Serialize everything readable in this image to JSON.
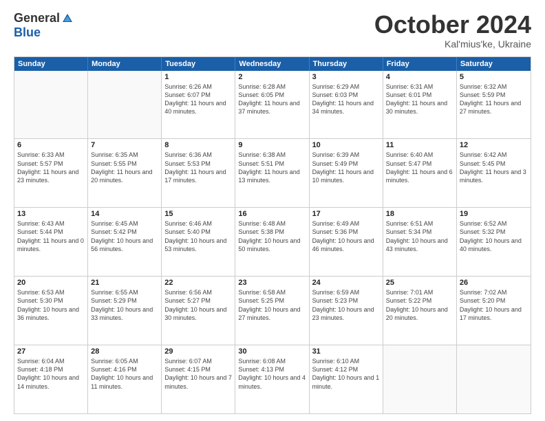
{
  "header": {
    "logo_general": "General",
    "logo_blue": "Blue",
    "month_title": "October 2024",
    "subtitle": "Kal'mius'ke, Ukraine"
  },
  "weekdays": [
    "Sunday",
    "Monday",
    "Tuesday",
    "Wednesday",
    "Thursday",
    "Friday",
    "Saturday"
  ],
  "rows": [
    [
      {
        "day": "",
        "sunrise": "",
        "sunset": "",
        "daylight": ""
      },
      {
        "day": "",
        "sunrise": "",
        "sunset": "",
        "daylight": ""
      },
      {
        "day": "1",
        "sunrise": "Sunrise: 6:26 AM",
        "sunset": "Sunset: 6:07 PM",
        "daylight": "Daylight: 11 hours and 40 minutes."
      },
      {
        "day": "2",
        "sunrise": "Sunrise: 6:28 AM",
        "sunset": "Sunset: 6:05 PM",
        "daylight": "Daylight: 11 hours and 37 minutes."
      },
      {
        "day": "3",
        "sunrise": "Sunrise: 6:29 AM",
        "sunset": "Sunset: 6:03 PM",
        "daylight": "Daylight: 11 hours and 34 minutes."
      },
      {
        "day": "4",
        "sunrise": "Sunrise: 6:31 AM",
        "sunset": "Sunset: 6:01 PM",
        "daylight": "Daylight: 11 hours and 30 minutes."
      },
      {
        "day": "5",
        "sunrise": "Sunrise: 6:32 AM",
        "sunset": "Sunset: 5:59 PM",
        "daylight": "Daylight: 11 hours and 27 minutes."
      }
    ],
    [
      {
        "day": "6",
        "sunrise": "Sunrise: 6:33 AM",
        "sunset": "Sunset: 5:57 PM",
        "daylight": "Daylight: 11 hours and 23 minutes."
      },
      {
        "day": "7",
        "sunrise": "Sunrise: 6:35 AM",
        "sunset": "Sunset: 5:55 PM",
        "daylight": "Daylight: 11 hours and 20 minutes."
      },
      {
        "day": "8",
        "sunrise": "Sunrise: 6:36 AM",
        "sunset": "Sunset: 5:53 PM",
        "daylight": "Daylight: 11 hours and 17 minutes."
      },
      {
        "day": "9",
        "sunrise": "Sunrise: 6:38 AM",
        "sunset": "Sunset: 5:51 PM",
        "daylight": "Daylight: 11 hours and 13 minutes."
      },
      {
        "day": "10",
        "sunrise": "Sunrise: 6:39 AM",
        "sunset": "Sunset: 5:49 PM",
        "daylight": "Daylight: 11 hours and 10 minutes."
      },
      {
        "day": "11",
        "sunrise": "Sunrise: 6:40 AM",
        "sunset": "Sunset: 5:47 PM",
        "daylight": "Daylight: 11 hours and 6 minutes."
      },
      {
        "day": "12",
        "sunrise": "Sunrise: 6:42 AM",
        "sunset": "Sunset: 5:45 PM",
        "daylight": "Daylight: 11 hours and 3 minutes."
      }
    ],
    [
      {
        "day": "13",
        "sunrise": "Sunrise: 6:43 AM",
        "sunset": "Sunset: 5:44 PM",
        "daylight": "Daylight: 11 hours and 0 minutes."
      },
      {
        "day": "14",
        "sunrise": "Sunrise: 6:45 AM",
        "sunset": "Sunset: 5:42 PM",
        "daylight": "Daylight: 10 hours and 56 minutes."
      },
      {
        "day": "15",
        "sunrise": "Sunrise: 6:46 AM",
        "sunset": "Sunset: 5:40 PM",
        "daylight": "Daylight: 10 hours and 53 minutes."
      },
      {
        "day": "16",
        "sunrise": "Sunrise: 6:48 AM",
        "sunset": "Sunset: 5:38 PM",
        "daylight": "Daylight: 10 hours and 50 minutes."
      },
      {
        "day": "17",
        "sunrise": "Sunrise: 6:49 AM",
        "sunset": "Sunset: 5:36 PM",
        "daylight": "Daylight: 10 hours and 46 minutes."
      },
      {
        "day": "18",
        "sunrise": "Sunrise: 6:51 AM",
        "sunset": "Sunset: 5:34 PM",
        "daylight": "Daylight: 10 hours and 43 minutes."
      },
      {
        "day": "19",
        "sunrise": "Sunrise: 6:52 AM",
        "sunset": "Sunset: 5:32 PM",
        "daylight": "Daylight: 10 hours and 40 minutes."
      }
    ],
    [
      {
        "day": "20",
        "sunrise": "Sunrise: 6:53 AM",
        "sunset": "Sunset: 5:30 PM",
        "daylight": "Daylight: 10 hours and 36 minutes."
      },
      {
        "day": "21",
        "sunrise": "Sunrise: 6:55 AM",
        "sunset": "Sunset: 5:29 PM",
        "daylight": "Daylight: 10 hours and 33 minutes."
      },
      {
        "day": "22",
        "sunrise": "Sunrise: 6:56 AM",
        "sunset": "Sunset: 5:27 PM",
        "daylight": "Daylight: 10 hours and 30 minutes."
      },
      {
        "day": "23",
        "sunrise": "Sunrise: 6:58 AM",
        "sunset": "Sunset: 5:25 PM",
        "daylight": "Daylight: 10 hours and 27 minutes."
      },
      {
        "day": "24",
        "sunrise": "Sunrise: 6:59 AM",
        "sunset": "Sunset: 5:23 PM",
        "daylight": "Daylight: 10 hours and 23 minutes."
      },
      {
        "day": "25",
        "sunrise": "Sunrise: 7:01 AM",
        "sunset": "Sunset: 5:22 PM",
        "daylight": "Daylight: 10 hours and 20 minutes."
      },
      {
        "day": "26",
        "sunrise": "Sunrise: 7:02 AM",
        "sunset": "Sunset: 5:20 PM",
        "daylight": "Daylight: 10 hours and 17 minutes."
      }
    ],
    [
      {
        "day": "27",
        "sunrise": "Sunrise: 6:04 AM",
        "sunset": "Sunset: 4:18 PM",
        "daylight": "Daylight: 10 hours and 14 minutes."
      },
      {
        "day": "28",
        "sunrise": "Sunrise: 6:05 AM",
        "sunset": "Sunset: 4:16 PM",
        "daylight": "Daylight: 10 hours and 11 minutes."
      },
      {
        "day": "29",
        "sunrise": "Sunrise: 6:07 AM",
        "sunset": "Sunset: 4:15 PM",
        "daylight": "Daylight: 10 hours and 7 minutes."
      },
      {
        "day": "30",
        "sunrise": "Sunrise: 6:08 AM",
        "sunset": "Sunset: 4:13 PM",
        "daylight": "Daylight: 10 hours and 4 minutes."
      },
      {
        "day": "31",
        "sunrise": "Sunrise: 6:10 AM",
        "sunset": "Sunset: 4:12 PM",
        "daylight": "Daylight: 10 hours and 1 minute."
      },
      {
        "day": "",
        "sunrise": "",
        "sunset": "",
        "daylight": ""
      },
      {
        "day": "",
        "sunrise": "",
        "sunset": "",
        "daylight": ""
      }
    ]
  ]
}
